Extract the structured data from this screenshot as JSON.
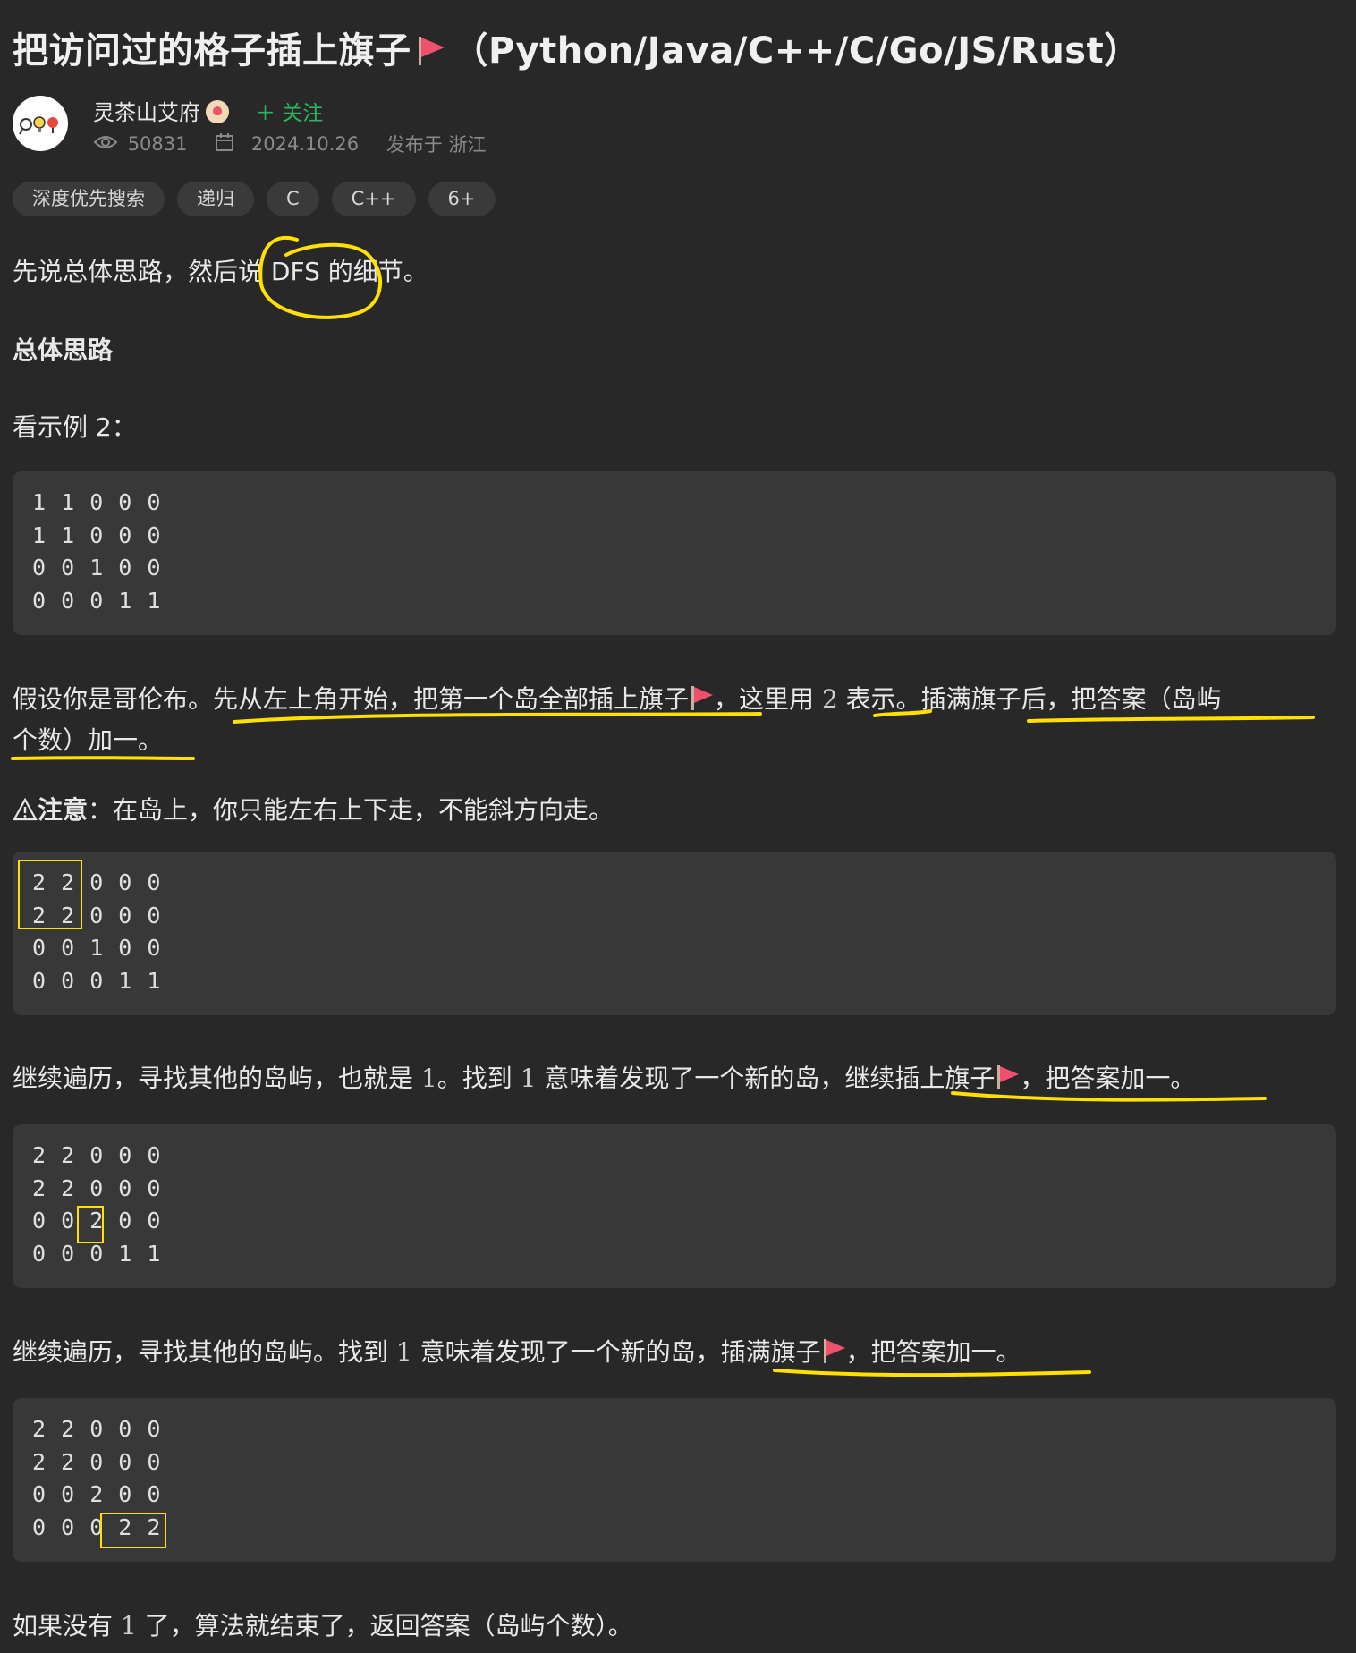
{
  "header": {
    "title_main": "把访问过的格子插上旗子",
    "title_langs": "（Python/Java/C++/C/Go/JS/Rust）",
    "author_name": "灵茶山艾府",
    "follow_label": "＋ 关注",
    "views": "50831",
    "date": "2024.10.26",
    "location": "发布于 浙江"
  },
  "tags": [
    "深度优先搜索",
    "递归",
    "C",
    "C++",
    "6+"
  ],
  "content": {
    "intro": "先说总体思路，然后说 DFS 的细节。",
    "section_title": "总体思路",
    "example_label": "看示例 2：",
    "grid1": [
      "1 1 0 0 0",
      "1 1 0 0 0",
      "0 0 1 0 0",
      "0 0 0 1 1"
    ],
    "para1_line1_a": "假设你是哥伦布。先从左上角开始，把第一个岛全部插上旗子",
    "para1_line1_b": "，这里用",
    "para1_num": "2",
    "para1_line1_c": "表示。插满旗子后，把答案（岛屿",
    "para1_line2": "个数）加一。",
    "note_bold": "注意",
    "note_text": "：在岛上，你只能左右上下走，不能斜方向走。",
    "grid2": [
      "2 2 0 0 0",
      "2 2 0 0 0",
      "0 0 1 0 0",
      "0 0 0 1 1"
    ],
    "para2_a": "继续遍历，寻找其他的岛屿，也就是",
    "para2_num1": "1",
    "para2_b": "。找到",
    "para2_num2": "1",
    "para2_c": "意味着发现了一个新的岛，继续插上旗子",
    "para2_d": "，把答案加一。",
    "grid3": [
      "2 2 0 0 0",
      "2 2 0 0 0",
      "0 0 2 0 0",
      "0 0 0 1 1"
    ],
    "para3_a": "继续遍历，寻找其他的岛屿。找到",
    "para3_num": "1",
    "para3_b": "意味着发现了一个新的岛，插满旗子",
    "para3_c": "，把答案加一。",
    "grid4": [
      "2 2 0 0 0",
      "2 2 0 0 0",
      "0 0 2 0 0",
      "0 0 0 2 2"
    ],
    "para4_a": "如果没有",
    "para4_num": "1",
    "para4_b": "了，算法就结束了，返回答案（岛屿个数）。"
  },
  "colors": {
    "background": "#282828",
    "code_bg": "#383838",
    "follow": "#2db55d",
    "annotation": "#ffe000",
    "flag": "#f0506e"
  },
  "icons": [
    "flag-icon",
    "eye-icon",
    "calendar-icon",
    "warning-icon"
  ]
}
